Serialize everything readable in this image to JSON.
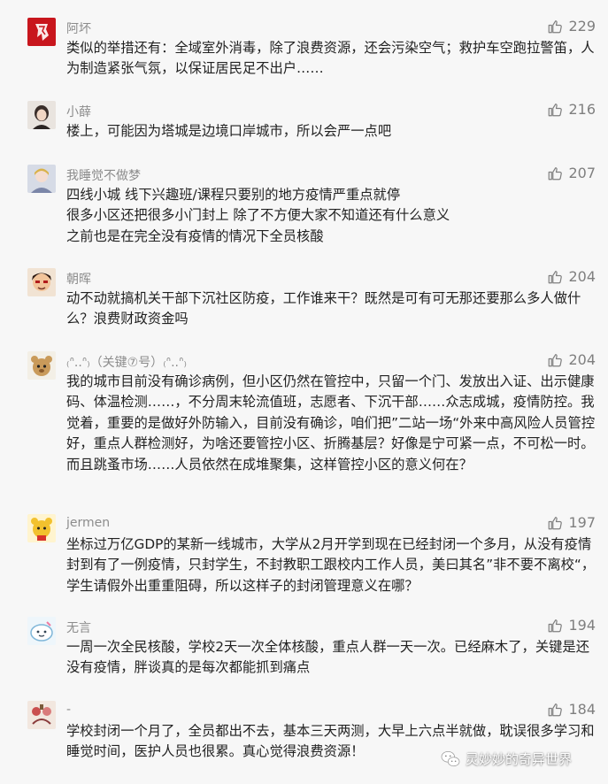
{
  "comments": [
    {
      "name": "阿坏",
      "likes": "229",
      "text": "类似的举措还有：全域室外消毒，除了浪费资源，还会污染空气；救护车空跑拉警笛，人为制造紧张气氛，以保证居民足不出户……"
    },
    {
      "name": "小薛",
      "likes": "216",
      "text": "楼上，可能因为塔城是边境口岸城市，所以会严一点吧"
    },
    {
      "name": "我睡觉不做梦",
      "likes": "207",
      "text": "四线小城 线下兴趣班/课程只要别的地方疫情严重点就停\n很多小区还把很多小门封上 除了不方便大家不知道还有什么意义\n之前也是在完全没有疫情的情况下全员核酸"
    },
    {
      "name": "朝晖",
      "likes": "204",
      "text": "动不动就搞机关干部下沉社区防疫，工作谁来干？既然是可有可无那还要那么多人做什么？浪费财政资金吗"
    },
    {
      "name": "₍ᐢ..ᐢ₎（关键⑦号）₍ᐢ..ᐢ₎",
      "likes": "204",
      "text": "我的城市目前没有确诊病例，但小区仍然在管控中，只留一个门、发放出入证、出示健康码、体温检测……，不分周末轮流值班，志愿者、下沉干部……众志成城，疫情防控。我觉着，重要的是做好外防输入，目前没有确诊，咱们把”二站一场“外来中高风险人员管控好，重点人群检测好，为啥还要管控小区、折腾基层？好像是宁可紧一点，不可松一时。而且跳蚤市场……人员依然在成堆聚集，这样管控小区的意义何在？"
    },
    {
      "name": "jermen",
      "likes": "197",
      "text": "坐标过万亿GDP的某新一线城市，大学从2月开学到现在已经封闭一个多月，从没有疫情封到有了一例疫情，只封学生，不封教职工跟校内工作人员，美曰其名”非不要不离校“，学生请假外出重重阻碍，所以这样子的封闭管理意义在哪？"
    },
    {
      "name": "无言",
      "likes": "194",
      "text": "一周一次全民核酸，学校2天一次全体核酸，重点人群一天一次。已经麻木了，关键是还没有疫情，胖谈真的是每次都能抓到痛点"
    },
    {
      "name": "-",
      "likes": "184",
      "text": "学校封闭一个月了，全员都出不去，基本三天两测，大早上六点半就做，耽误很多学习和睡觉时间，医护人员也很累。真心觉得浪费资源！"
    }
  ],
  "watermark": "灵妙妙的奇异世界"
}
